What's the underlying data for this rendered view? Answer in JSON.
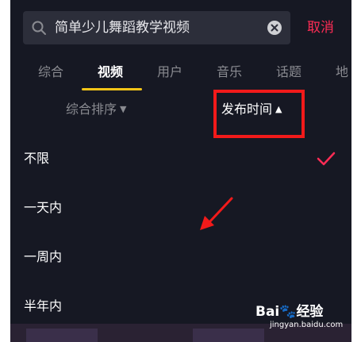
{
  "search": {
    "query": "简单少儿舞蹈教学视频",
    "cancel_label": "取消"
  },
  "tabs": [
    {
      "label": "综合",
      "active": false
    },
    {
      "label": "视频",
      "active": true
    },
    {
      "label": "用户",
      "active": false
    },
    {
      "label": "音乐",
      "active": false
    },
    {
      "label": "话题",
      "active": false
    },
    {
      "label": "地",
      "active": false
    }
  ],
  "filters": {
    "sort": {
      "label": "综合排序",
      "caret": "▼"
    },
    "time": {
      "label": "发布时间",
      "caret": "▲"
    }
  },
  "time_options": [
    {
      "label": "不限",
      "selected": true
    },
    {
      "label": "一天内",
      "selected": false
    },
    {
      "label": "一周内",
      "selected": false
    },
    {
      "label": "半年内",
      "selected": false
    }
  ],
  "watermark": {
    "logo_text": "Bai",
    "logo_suffix": "经验",
    "sub": "jingyan.baidu.com"
  },
  "colors": {
    "background": "#161823",
    "accent": "#fe2c55",
    "tab_underline": "#f5c518",
    "annotation": "#f21a1a"
  }
}
